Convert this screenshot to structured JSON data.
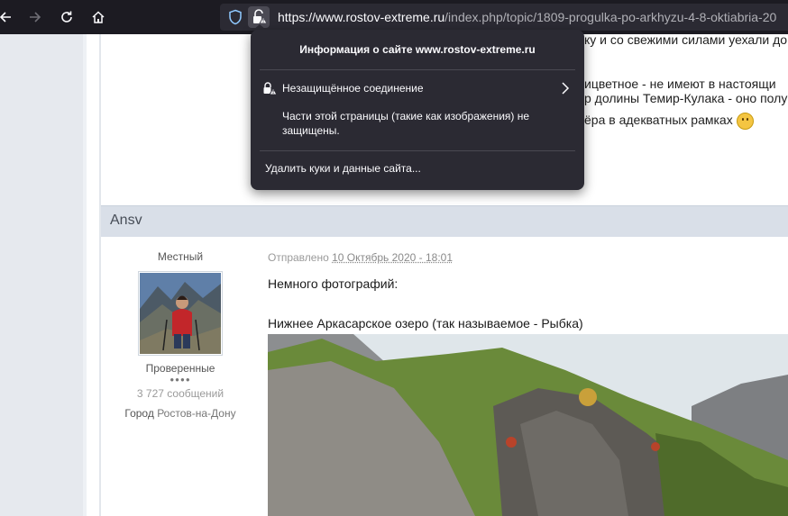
{
  "browser": {
    "url_domain": "https://www.rostov-extreme.ru",
    "url_path": "/index.php/topic/1809-progulka-po-arkhyzu-4-8-oktiabria-20"
  },
  "site_info_popup": {
    "title": "Информация о сайте www.rostov-extreme.ru",
    "connection_label": "Незащищённое соединение",
    "connection_desc": "Части этой страницы (такие как изображения) не защищены.",
    "clear_cookies_label": "Удалить куки и данные сайта..."
  },
  "previous_post": {
    "line1": "ку и со свежими силами уехали до",
    "line2": "ицветное - не имеют в настоящи",
    "line3": "р долины Темир-Кулака - оно полу",
    "line4": "ёра в адекватных рамках"
  },
  "post": {
    "author": "Ansv",
    "rank": "Местный",
    "group": "Проверенные",
    "pips": "●●●●",
    "posts_count": "3 727 сообщений",
    "city_label": "Город",
    "city_value": "Ростов-на-Дону",
    "sent_label": "Отправлено",
    "date": "10 Октябрь 2020 - 18:01",
    "text1": "Немного фотографий:",
    "text2": "Нижнее Аркасарское озеро (так называемое - Рыбка)"
  },
  "colors": {
    "toolbar_bg": "#1c1b22",
    "urlbar_bg": "#2b2a33",
    "popup_bg": "#2b2a33",
    "post_header_bg": "#d9dfe8"
  }
}
